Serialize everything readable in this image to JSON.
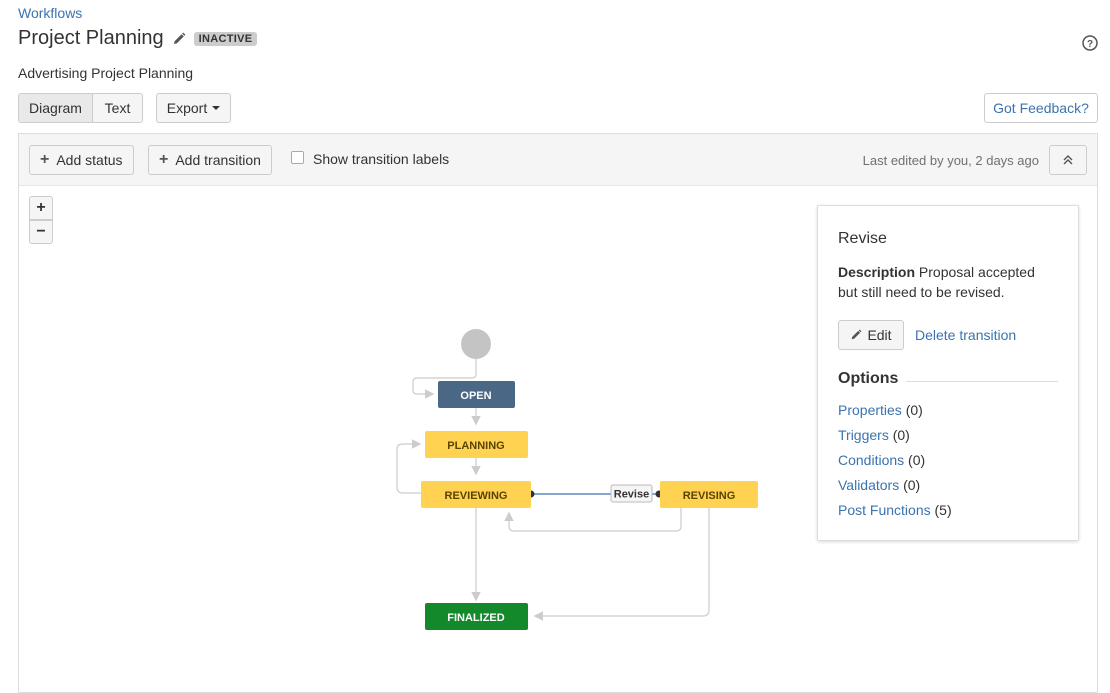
{
  "breadcrumb": "Workflows",
  "title": "Project Planning",
  "status_lozenge": "INACTIVE",
  "subtitle": "Advertising Project Planning",
  "view_tabs": {
    "diagram": "Diagram",
    "text": "Text"
  },
  "export_label": "Export",
  "feedback_label": "Got Feedback?",
  "toolbar": {
    "add_status": "Add status",
    "add_transition": "Add transition",
    "show_labels": "Show transition labels",
    "last_edited": "Last edited by you, 2 days ago"
  },
  "zoom": {
    "in": "+",
    "out": "−"
  },
  "diagram": {
    "statuses": {
      "open": "OPEN",
      "planning": "PLANNING",
      "reviewing": "REVIEWING",
      "revising": "REVISING",
      "finalized": "FINALIZED"
    },
    "transition_label": "Revise",
    "colors": {
      "open": "#4a6785",
      "in_progress": "#ffd351",
      "done": "#14892c",
      "selected_line": "#3b73af",
      "line": "#cccccc"
    }
  },
  "panel": {
    "title": "Revise",
    "description_label": "Description",
    "description_text": "Proposal accepted but still need to be revised.",
    "edit_label": "Edit",
    "delete_label": "Delete transition",
    "options_heading": "Options",
    "options": [
      {
        "label": "Properties",
        "count": "(0)"
      },
      {
        "label": "Triggers",
        "count": "(0)"
      },
      {
        "label": "Conditions",
        "count": "(0)"
      },
      {
        "label": "Validators",
        "count": "(0)"
      },
      {
        "label": "Post Functions",
        "count": "(5)"
      }
    ]
  },
  "icons": [
    "pencil-icon",
    "help-icon",
    "caret-down-icon",
    "plus-icon",
    "checkbox",
    "double-chevron-up-icon"
  ]
}
